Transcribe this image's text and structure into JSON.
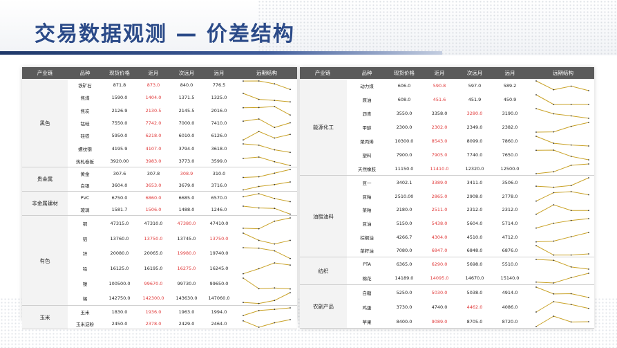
{
  "title": "交易数据观测 — 价差结构",
  "header": [
    "产业链",
    "品种",
    "现货价格",
    "近月",
    "次远月",
    "远月",
    "远期结构"
  ],
  "colors": {
    "near_month_red": "#e03a3a",
    "spark_line": "#c9a227",
    "header_bg": "#5a5a5a",
    "title_blue": "#2b4a88"
  },
  "left": [
    {
      "name": "黑色",
      "rows": [
        {
          "p": "铁矿石",
          "spot": "871.8",
          "near": "873.0",
          "next": "840.0",
          "far": "776.5",
          "red": "near"
        },
        {
          "p": "焦煤",
          "spot": "1590.0",
          "near": "1404.0",
          "next": "1371.5",
          "far": "1325.0",
          "red": "near"
        },
        {
          "p": "焦炭",
          "spot": "2126.9",
          "near": "2130.5",
          "next": "2145.5",
          "far": "2016.0",
          "red": "near"
        },
        {
          "p": "锰硅",
          "spot": "7550.0",
          "near": "7742.0",
          "next": "7000.0",
          "far": "7410.0",
          "red": "near"
        },
        {
          "p": "硅铁",
          "spot": "5950.0",
          "near": "6218.0",
          "next": "6010.0",
          "far": "6126.0",
          "red": "near"
        },
        {
          "p": "螺纹钢",
          "spot": "4195.9",
          "near": "4107.0",
          "next": "3794.0",
          "far": "3618.0",
          "red": "near"
        },
        {
          "p": "热轧卷板",
          "spot": "3920.00",
          "near": "3983.0",
          "next": "3773.0",
          "far": "3599.0",
          "red": "near"
        }
      ]
    },
    {
      "name": "贵金属",
      "rows": [
        {
          "p": "黄金",
          "spot": "307.6",
          "near": "307.8",
          "next": "308.9",
          "far": "310.0",
          "red": "next"
        },
        {
          "p": "白银",
          "spot": "3604.0",
          "near": "3653.0",
          "next": "3679.0",
          "far": "3716.0",
          "red": "near"
        }
      ]
    },
    {
      "name": "非金属建材",
      "rows": [
        {
          "p": "PVC",
          "spot": "6750.0",
          "near": "6860.0",
          "next": "6685.0",
          "far": "6570.0",
          "red": "near"
        },
        {
          "p": "玻璃",
          "spot": "1581.7",
          "near": "1506.0",
          "next": "1488.0",
          "far": "1246.0",
          "red": "near"
        }
      ]
    },
    {
      "name": "有色",
      "rows": [
        {
          "p": "铜",
          "spot": "47315.0",
          "near": "47310.0",
          "next": "47380.0",
          "far": "47410.0",
          "red": "next"
        },
        {
          "p": "铝",
          "spot": "13760.0",
          "near": "13750.0",
          "next": "13745.0",
          "far": "13750.0",
          "red": "near_far"
        },
        {
          "p": "锌",
          "spot": "20080.0",
          "near": "20065.0",
          "next": "19980.0",
          "far": "19740.0",
          "red": "next"
        },
        {
          "p": "铅",
          "spot": "16125.0",
          "near": "16195.0",
          "next": "16275.0",
          "far": "16245.0",
          "red": "next"
        },
        {
          "p": "镍",
          "spot": "100500.0",
          "near": "99670.0",
          "next": "99730.0",
          "far": "99650.0",
          "red": "near"
        },
        {
          "p": "锡",
          "spot": "142750.0",
          "near": "142300.0",
          "next": "143630.0",
          "far": "147060.0",
          "red": "near"
        }
      ]
    },
    {
      "name": "玉米",
      "rows": [
        {
          "p": "玉米",
          "spot": "1830.0",
          "near": "1936.0",
          "next": "1963.0",
          "far": "1994.0",
          "red": "near"
        },
        {
          "p": "玉米淀粉",
          "spot": "2450.0",
          "near": "2378.0",
          "next": "2429.0",
          "far": "2464.0",
          "red": "near"
        }
      ]
    }
  ],
  "right": [
    {
      "name": "能源化工",
      "rows": [
        {
          "p": "动力煤",
          "spot": "606.0",
          "near": "590.8",
          "next": "597.0",
          "far": "589.2",
          "red": "near"
        },
        {
          "p": "原油",
          "spot": "608.0",
          "near": "451.6",
          "next": "451.9",
          "far": "450.9",
          "red": "near"
        },
        {
          "p": "沥青",
          "spot": "3550.0",
          "near": "3358.0",
          "next": "3280.0",
          "far": "3190.0",
          "red": "next"
        },
        {
          "p": "甲醇",
          "spot": "2300.0",
          "near": "2302.0",
          "next": "2349.0",
          "far": "2382.0",
          "red": "near"
        },
        {
          "p": "聚丙烯",
          "spot": "10300.0",
          "near": "8543.0",
          "next": "8099.0",
          "far": "7860.0",
          "red": "near"
        },
        {
          "p": "塑料",
          "spot": "7900.0",
          "near": "7905.0",
          "next": "7740.0",
          "far": "7650.0",
          "red": "near"
        },
        {
          "p": "天然橡胶",
          "spot": "11150.0",
          "near": "11410.0",
          "next": "12320.0",
          "far": "12500.0",
          "red": "near"
        }
      ]
    },
    {
      "name": "油脂油料",
      "rows": [
        {
          "p": "豆一",
          "spot": "3402.1",
          "near": "3389.0",
          "next": "3411.0",
          "far": "3506.0",
          "red": "near"
        },
        {
          "p": "豆粕",
          "spot": "2510.00",
          "near": "2865.0",
          "next": "2908.0",
          "far": "2778.0",
          "red": "near"
        },
        {
          "p": "菜粕",
          "spot": "2180.0",
          "near": "2511.0",
          "next": "2312.0",
          "far": "2312.0",
          "red": "near"
        },
        {
          "p": "豆油",
          "spot": "5150.0",
          "near": "5438.0",
          "next": "5604.0",
          "far": "5714.0",
          "red": "near"
        },
        {
          "p": "棕榈油",
          "spot": "4266.7",
          "near": "4304.0",
          "next": "4510.0",
          "far": "4712.0",
          "red": "near"
        },
        {
          "p": "菜籽油",
          "spot": "7080.0",
          "near": "6847.0",
          "next": "6848.0",
          "far": "6876.0",
          "red": "near"
        }
      ]
    },
    {
      "name": "纺织",
      "rows": [
        {
          "p": "PTA",
          "spot": "6365.0",
          "near": "6290.0",
          "next": "5698.0",
          "far": "5510.0",
          "red": "near"
        },
        {
          "p": "棉花",
          "spot": "14189.0",
          "near": "14095.0",
          "next": "14670.0",
          "far": "15140.0",
          "red": "near"
        }
      ]
    },
    {
      "name": "农副产品",
      "rows": [
        {
          "p": "白糖",
          "spot": "5250.0",
          "near": "5030.0",
          "next": "5038.0",
          "far": "4914.0",
          "red": "near"
        },
        {
          "p": "鸡蛋",
          "spot": "3730.0",
          "near": "4740.0",
          "next": "4462.0",
          "far": "4086.0",
          "red": "next"
        },
        {
          "p": "苹果",
          "spot": "8400.0",
          "near": "9089.0",
          "next": "8705.0",
          "far": "8720.0",
          "red": "near"
        }
      ]
    }
  ]
}
